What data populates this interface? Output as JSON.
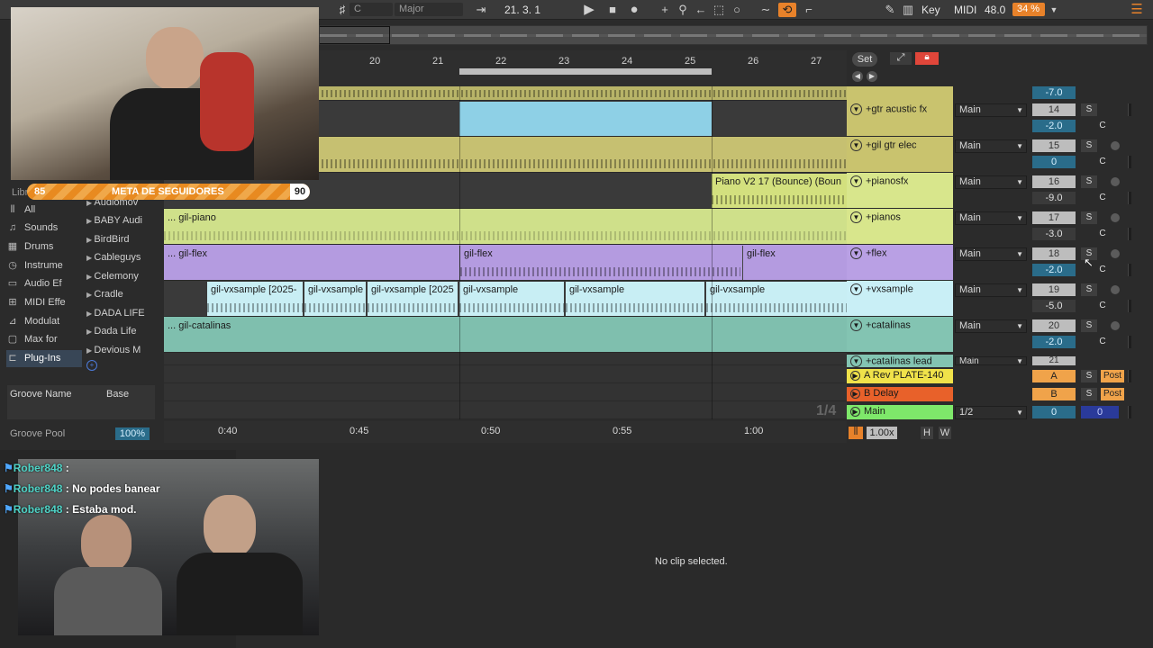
{
  "topbar": {
    "key_sel": "C",
    "scale_sel": "Major",
    "position": "21.  3.  1",
    "key_label": "Key",
    "midi_label": "MIDI",
    "cpu": "48.0",
    "zoom": "34 %"
  },
  "stream": {
    "goal_left": "85",
    "goal_title": "META DE SEGUIDORES",
    "goal_right": "90",
    "chat": [
      {
        "user": "Rober848",
        "msg": ""
      },
      {
        "user": "Rober848",
        "msg": "No podes banear"
      },
      {
        "user": "Rober848",
        "msg": "Estaba mod."
      }
    ]
  },
  "ruler": {
    "bars": [
      "20",
      "21",
      "22",
      "23",
      "24",
      "25",
      "26",
      "27"
    ],
    "times": [
      "0:40",
      "0:45",
      "0:50",
      "0:55",
      "1:00"
    ],
    "set_label": "Set"
  },
  "browser": {
    "lib_label": "Libr",
    "categories": [
      "All",
      "Sounds",
      "Drums",
      "Instrume",
      "Audio Ef",
      "MIDI Effe",
      "Modulat",
      "Max for",
      "Plug-Ins"
    ],
    "items": [
      "Audiomov",
      "BABY Audi",
      "BirdBird",
      "Cableguys",
      "Celemony",
      "Cradle",
      "DADA LIFE",
      "Dada Life",
      "Devious M"
    ],
    "groove_name": "Groove Name",
    "groove_base": "Base",
    "groove_pool": "Groove Pool",
    "groove_pct": "100%"
  },
  "tracks": [
    {
      "name": "+gtr acustic fx",
      "out": "Main",
      "num": "14",
      "vol": "-2.0",
      "pan": "C"
    },
    {
      "name": "+gil gtr elec",
      "out": "Main",
      "num": "15",
      "vol": "0",
      "pan": "C"
    },
    {
      "name": "+pianosfx",
      "out": "Main",
      "num": "16",
      "vol": "-9.0",
      "pan": "C"
    },
    {
      "name": "+pianos",
      "out": "Main",
      "num": "17",
      "vol": "-3.0",
      "pan": "C"
    },
    {
      "name": "+flex",
      "out": "Main",
      "num": "18",
      "vol": "-2.0",
      "pan": "C"
    },
    {
      "name": "+vxsample",
      "out": "Main",
      "num": "19",
      "vol": "-5.0",
      "pan": "C"
    },
    {
      "name": "+catalinas",
      "out": "Main",
      "num": "20",
      "vol": "-2.0",
      "pan": "C"
    },
    {
      "name": "+catalinas lead",
      "out": "Main",
      "num": "21",
      "vol": "",
      "pan": ""
    }
  ],
  "top_partial_vol": "-7.0",
  "returns": [
    {
      "name": "A Rev PLATE-140",
      "letter": "A",
      "post": "Post"
    },
    {
      "name": "B Delay",
      "letter": "B",
      "post": "Post"
    }
  ],
  "main": {
    "name": "Main",
    "out": "1/2",
    "vol": "0",
    "pan": "0"
  },
  "clips": {
    "piano_bounce": "Piano V2 17 (Bounce) (Boun",
    "gil_piano": "... gil-piano",
    "gil_flex_1": "... gil-flex",
    "gil_flex_2": "gil-flex",
    "gil_flex_3": "gil-flex",
    "vx": [
      "gil-vxsample [2025-",
      "gil-vxsample",
      "gil-vxsample [2025",
      "gil-vxsample",
      "gil-vxsample",
      "gil-vxsample"
    ],
    "catalinas": "... gil-catalinas"
  },
  "grid_quant": "1/4",
  "tempo_scale": "1.00x",
  "hw": [
    "H",
    "W"
  ],
  "detail": "No clip selected."
}
